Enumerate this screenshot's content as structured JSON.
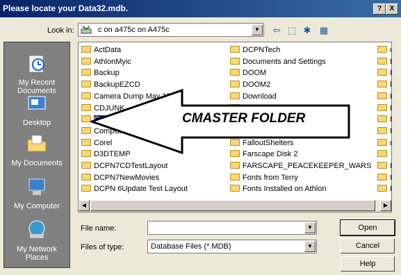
{
  "window": {
    "title": "Please locate your Data32.mdb.",
    "help_btn": "?",
    "close_btn": "X"
  },
  "lookin": {
    "label": "Look in:",
    "value": "c on a475c on A475c"
  },
  "places": [
    {
      "label": "My Recent Documents",
      "icon": "recent-documents-icon"
    },
    {
      "label": "Desktop",
      "icon": "desktop-icon"
    },
    {
      "label": "My Documents",
      "icon": "my-documents-icon"
    },
    {
      "label": "My Computer",
      "icon": "my-computer-icon"
    },
    {
      "label": "My Network Places",
      "icon": "network-places-icon"
    }
  ],
  "files": {
    "col1": [
      "ActData",
      "AthlonMyic",
      "Backup",
      "BackupEZCD",
      "Camera Dump May 19 2",
      "CDJUNK",
      "Cmaster",
      "CompChecker",
      "Corel",
      "D3DTEMP",
      "DCPN7CDTestLayout",
      "DCPN7NewMovies",
      "DCPN 6Update Test Layout"
    ],
    "col2": [
      "DCPNTech",
      "Documents and Settings",
      "DOOM",
      "DOOM2",
      "Download",
      "",
      "",
      "EPSONREG",
      "FalloutShelters",
      "Farscape Disk 2",
      "FARSCAPE_PEACEKEEPER_WARS",
      "Fonts from Terry",
      "Fonts Installed on Athlon"
    ],
    "col3_partial": [
      "d",
      "I",
      "I",
      "k",
      "L",
      "L",
      "I",
      "I",
      "r",
      "",
      "I",
      "I",
      "I"
    ],
    "selected": "Cmaster"
  },
  "annotation": {
    "text": "CMASTER FOLDER"
  },
  "filename": {
    "label": "File name:",
    "value": ""
  },
  "filetype": {
    "label": "Files of type:",
    "value": "Database Files (*.MDB)"
  },
  "buttons": {
    "open": "Open",
    "cancel": "Cancel",
    "help": "Help"
  }
}
